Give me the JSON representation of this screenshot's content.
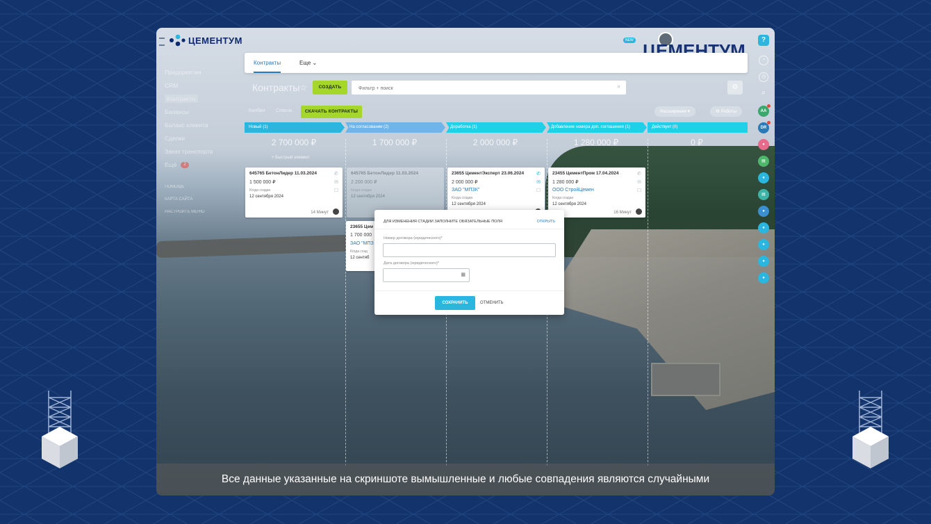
{
  "app": {
    "logo_text": "ЦЕМЕНТУМ",
    "brand_watermark": "ЦЕМЕНТУМ",
    "new_badge": "NEW"
  },
  "colors": {
    "accent": "#2bb6e0",
    "green": "#a5d72b",
    "page_bg": "#12336b",
    "link": "#2a7ab8"
  },
  "sidebar": {
    "items": [
      {
        "label": "Предприятия"
      },
      {
        "label": "CRM"
      },
      {
        "label": "Контракты"
      },
      {
        "label": "Балансы"
      },
      {
        "label": "Баланс клиента"
      },
      {
        "label": "Сделки"
      },
      {
        "label": "Заказ транспорта"
      },
      {
        "label": "Ещё",
        "badge": "2"
      }
    ],
    "small_links": [
      "ПОМОЩЬ",
      "КАРТА САЙТА",
      "НАСТРОИТЬ МЕНЮ"
    ]
  },
  "tabs": [
    {
      "label": "Контракты"
    },
    {
      "label": "Еще"
    }
  ],
  "toolbar": {
    "title": "Контракты",
    "create_label": "СОЗДАТЬ",
    "search_placeholder": "Фильтр + поиск",
    "view_kanban": "Канбан",
    "view_list": "Список",
    "download_label": "СКАЧАТЬ КОНТРАКТЫ",
    "extensions_label": "Расширения",
    "robots_label": "Роботы"
  },
  "columns": [
    {
      "name": "Новый",
      "count": "1",
      "total": "2 700 000 ₽",
      "color": "#2bb6e0"
    },
    {
      "name": "На согласовании",
      "count": "2",
      "total": "1 700 000 ₽",
      "color": "#6fb5ea"
    },
    {
      "name": "Доработка",
      "count": "1",
      "total": "2 000 000 ₽",
      "color": "#1fd0e8"
    },
    {
      "name": "Добавление номера доп. соглашения",
      "count": "1",
      "total": "1 280 000 ₽",
      "color": "#1fd0e8"
    },
    {
      "name": "Действует",
      "count": "0",
      "total": "0 ₽",
      "color": "#1fd0e8"
    }
  ],
  "quick_add": "+ Быстрый элемент",
  "cards": [
    {
      "title": "645765 БетонЛидер 11.03.2024",
      "sum": "1 500 000 ₽",
      "company": "",
      "created_label": "Когда создан",
      "date": "12 сентября 2024",
      "ago": "14 Минут"
    },
    {
      "title": "645765 БетонЛидер 11.03.2024",
      "sum": "2 200 000 ₽",
      "company": "",
      "created_label": "Когда создан",
      "date": "12 сентября 2024",
      "ago": ""
    },
    {
      "title": "23655 ЦементЭксперт 23.06.2024",
      "sum": "2 000 000 ₽",
      "company": "ЗАО \"МПЗК\"",
      "created_label": "Когда создан",
      "date": "12 сентября 2024",
      "ago": ""
    },
    {
      "title": "23455 ЦементПром 17.04.2024",
      "sum": "1 280 000 ₽",
      "company": "ООО СтройЦемен",
      "created_label": "Когда создан",
      "date": "12 сентября 2024",
      "ago": "16 Минут"
    },
    {
      "title": "23655 Цем",
      "sum": "1 700 000",
      "company": "ЗАО \"МПЗ",
      "created_label": "Когда созд",
      "date": "12 сентяб",
      "ago": ""
    }
  ],
  "modal": {
    "heading": "ДЛЯ ИЗМЕНЕНИЯ СТАДИИ ЗАПОЛНИТЕ ОБЯЗАТЕЛЬНЫЕ ПОЛЯ",
    "open_link": "ОТКРЫТЬ",
    "field1_label": "Номер договора (юридического)*",
    "field2_label": "Дата договора (юридического)*",
    "save_label": "СОХРАНИТЬ",
    "cancel_label": "ОТМЕНИТЬ"
  },
  "right_rail": {
    "initials": [
      "АА",
      "DR"
    ]
  },
  "disclaimer": "Все данные указанные на скриншоте вымышленные и любые совпадения являются случайными"
}
